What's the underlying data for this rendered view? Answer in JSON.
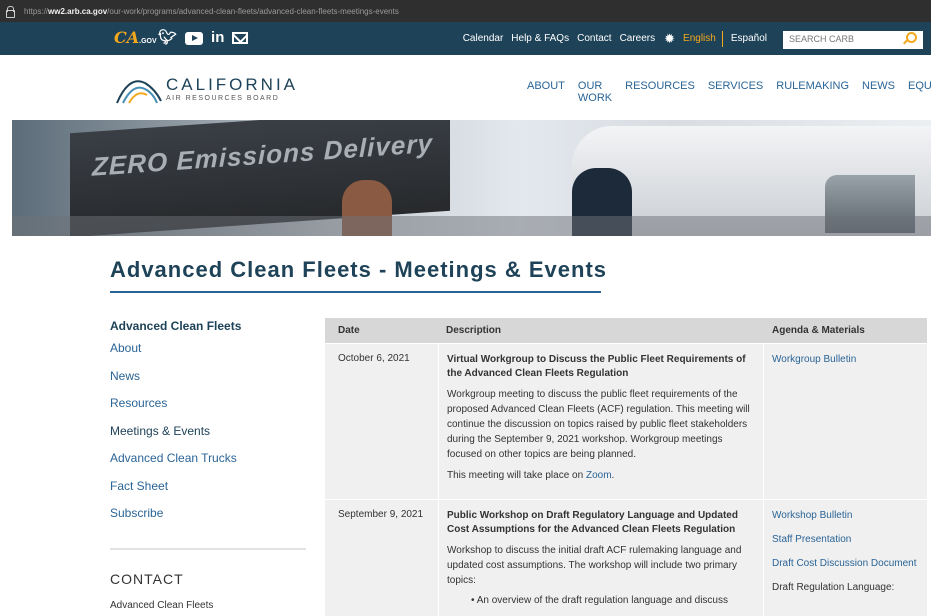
{
  "url": {
    "prefix": "https://",
    "host": "ww2.arb.ca.gov",
    "path": "/our-work/programs/advanced-clean-fleets/advanced-clean-fleets-meetings-events"
  },
  "topbar": {
    "cagov_logo": "CA",
    "cagov_sub": ".GOV",
    "social_icons": [
      "twitter-icon",
      "youtube-icon",
      "linkedin-icon",
      "email-icon"
    ],
    "links": [
      "Calendar",
      "Help & FAQs",
      "Contact",
      "Careers"
    ],
    "lang_english": "English",
    "lang_spanish": "Español",
    "search_placeholder": "SEARCH CARB"
  },
  "header": {
    "logo_name": "CALIFORNIA",
    "logo_sub": "AIR RESOURCES BOARD",
    "nav": [
      "ABOUT",
      "OUR WORK",
      "RESOURCES",
      "SERVICES",
      "RULEMAKING",
      "NEWS",
      "EQUITY"
    ]
  },
  "hero": {
    "truck_text": "ZERO Emissions Delivery"
  },
  "page_title": "Advanced Clean Fleets - Meetings & Events",
  "sidebar": {
    "heading": "Advanced Clean Fleets",
    "items": [
      "About",
      "News",
      "Resources",
      "Meetings & Events",
      "Advanced Clean Trucks",
      "Fact Sheet",
      "Subscribe"
    ]
  },
  "contact": {
    "heading": "CONTACT",
    "line1": "Advanced Clean Fleets"
  },
  "table": {
    "headers": [
      "Date",
      "Description",
      "Agenda & Materials"
    ],
    "rows": [
      {
        "date": "October 6, 2021",
        "title": "Virtual Workgroup to Discuss the Public Fleet Requirements of the Advanced Clean Fleets Regulation",
        "desc": "Workgroup meeting to discuss the public fleet requirements of the proposed Advanced Clean Fleets (ACF) regulation. This meeting will continue the discussion on topics raised by public fleet stakeholders during the September 9, 2021 workshop. Workgroup meetings focused on other topics are being planned.",
        "desc2_pre": "This meeting will take place on ",
        "desc2_link": "Zoom",
        "desc2_post": ".",
        "materials": [
          "Workgroup Bulletin"
        ]
      },
      {
        "date": "September 9, 2021",
        "title": "Public Workshop on Draft Regulatory Language and Updated Cost Assumptions for the Advanced Clean Fleets Regulation",
        "desc": "Workshop to discuss the initial draft ACF rulemaking language and updated cost assumptions. The workshop will include two primary topics:",
        "bullet": "• An overview of the draft regulation language and discuss",
        "materials": [
          "Workshop Bulletin",
          "Staff Presentation",
          "Draft Cost Discussion Document",
          "Draft Regulation Language:"
        ]
      }
    ]
  }
}
